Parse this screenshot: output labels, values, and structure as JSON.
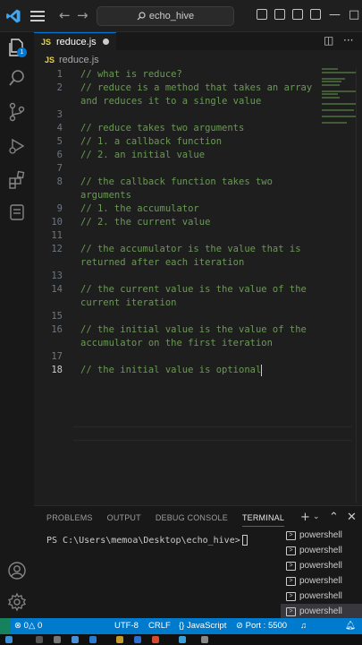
{
  "titlebar": {
    "search_text": "echo_hive"
  },
  "tab": {
    "filename": "reduce.js",
    "lang_badge": "JS"
  },
  "breadcrumb": {
    "badge": "JS",
    "filename": "reduce.js"
  },
  "activity": {
    "explorer_badge": "1"
  },
  "editor": {
    "lines": [
      {
        "num": "1",
        "text": "// what is reduce?"
      },
      {
        "num": "2",
        "text": "// reduce is a method that takes an array and reduces it to a single value"
      },
      {
        "num": "3",
        "text": ""
      },
      {
        "num": "4",
        "text": "// reduce takes two arguments"
      },
      {
        "num": "5",
        "text": "// 1. a callback function"
      },
      {
        "num": "6",
        "text": "// 2. an initial value"
      },
      {
        "num": "7",
        "text": ""
      },
      {
        "num": "8",
        "text": "// the callback function takes two arguments"
      },
      {
        "num": "9",
        "text": "// 1. the accumulator"
      },
      {
        "num": "10",
        "text": "// 2. the current value"
      },
      {
        "num": "11",
        "text": ""
      },
      {
        "num": "12",
        "text": "// the accumulator is the value that is returned after each iteration"
      },
      {
        "num": "13",
        "text": ""
      },
      {
        "num": "14",
        "text": "// the current value is the value of the current iteration"
      },
      {
        "num": "15",
        "text": ""
      },
      {
        "num": "16",
        "text": "// the initial value is the value of the accumulator on the first iteration"
      },
      {
        "num": "17",
        "text": ""
      },
      {
        "num": "18",
        "text": "// the initial value is optional"
      }
    ]
  },
  "panel": {
    "tabs": [
      "PROBLEMS",
      "OUTPUT",
      "DEBUG CONSOLE",
      "TERMINAL"
    ],
    "active_tab": "TERMINAL",
    "prompt": "PS C:\\Users\\memoa\\Desktop\\echo_hive>",
    "terminals": [
      "powershell",
      "powershell",
      "powershell",
      "powershell",
      "powershell",
      "powershell"
    ]
  },
  "statusbar": {
    "errors": "0",
    "warnings": "0",
    "encoding": "UTF-8",
    "eol": "CRLF",
    "language": "JavaScript",
    "port": "Port : 5500"
  }
}
